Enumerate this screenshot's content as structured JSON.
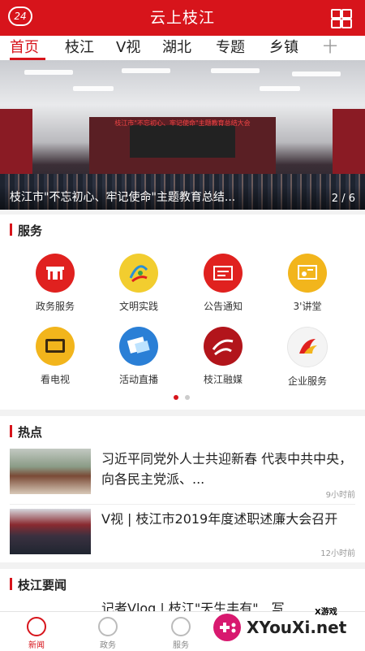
{
  "header": {
    "title": "云上枝江",
    "logo_text": "24"
  },
  "tabs": [
    "首页",
    "枝江",
    "V视",
    "湖北",
    "专题",
    "乡镇",
    "十"
  ],
  "banner": {
    "caption": "枝江市\"不忘初心、牢记使命\"主题教育总结...",
    "page_current": "2",
    "page_total": "6",
    "screen_text": "枝江市\"不忘初心、牢记使命\"主题教育总结大会"
  },
  "services": {
    "heading": "服务",
    "items": [
      {
        "label": "政务服务",
        "icon": "government-building-icon",
        "color": "#e0211f"
      },
      {
        "label": "文明实践",
        "icon": "civilization-practice-icon",
        "color": "#f2cd2f"
      },
      {
        "label": "公告通知",
        "icon": "notice-board-icon",
        "color": "#e0211f"
      },
      {
        "label": "3'讲堂",
        "icon": "lecture-hall-icon",
        "color": "#f2b51c"
      },
      {
        "label": "看电视",
        "icon": "tv-icon",
        "color": "#f2b51c"
      },
      {
        "label": "活动直播",
        "icon": "live-broadcast-icon",
        "color": "#2a7fd6"
      },
      {
        "label": "枝江融媒",
        "icon": "zhijiang-media-icon",
        "color": "#b2151b"
      },
      {
        "label": "企业服务",
        "icon": "enterprise-service-icon",
        "color": "#f4f4f4"
      }
    ]
  },
  "hot": {
    "heading": "热点",
    "items": [
      {
        "title": "习近平同党外人士共迎新春 代表中共中央，向各民主党派、...",
        "time": "9小时前"
      },
      {
        "title": "V视 | 枝江市2019年度述职述廉大会召开",
        "time": "12小时前"
      }
    ]
  },
  "local": {
    "heading": "枝江要闻",
    "first_title": "记者Vlog | 枝江\"天生丰有\"…写"
  },
  "bottom_nav": [
    {
      "label": "新闻",
      "icon": "news-icon",
      "active": true
    },
    {
      "label": "政务",
      "icon": "government-icon",
      "active": false
    },
    {
      "label": "服务",
      "icon": "service-icon",
      "active": false
    }
  ],
  "watermark": {
    "brand": "XYouXi.net",
    "tag": "X游戏"
  },
  "colors": {
    "brand_red": "#d7141b"
  }
}
